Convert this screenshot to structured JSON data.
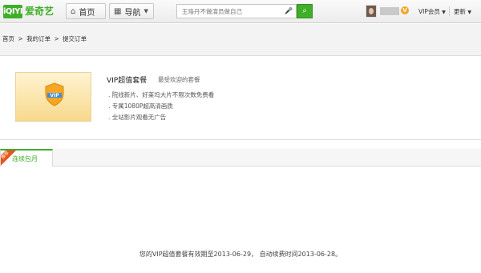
{
  "header": {
    "logo_mark": "iQIYI",
    "logo_text": "爱奇艺",
    "home_label": "首页",
    "nav_label": "导航",
    "search_placeholder": "王珞丹不做演员做自己",
    "vip_badge": "V",
    "vip_member_label": "VIP会员",
    "more_label": "更新"
  },
  "breadcrumb": {
    "items": [
      "首页",
      ">",
      "我的订单",
      ">",
      "提交订单"
    ]
  },
  "product": {
    "image_label": "VIP",
    "title": "VIP超值套餐",
    "subtitle": "最受欢迎的套餐",
    "features": [
      ". 院线新片、好莱坞大片不限次数免费看",
      ". 专属1080P超高清画质",
      ". 全站影片观看无广告"
    ]
  },
  "tabs": {
    "badge": "推荐",
    "active_label": "连续包月"
  },
  "status": {
    "prefix": "您的VIP超值套餐有效期至",
    "expiry_date": "2013-06-29",
    "middle": "，  自动续费时间",
    "renew_date": "2013-06-28",
    "suffix": "。"
  },
  "colors": {
    "brand_green": "#3fae29",
    "ribbon_orange": "#e8551c",
    "vip_gold": "#f5a623"
  }
}
